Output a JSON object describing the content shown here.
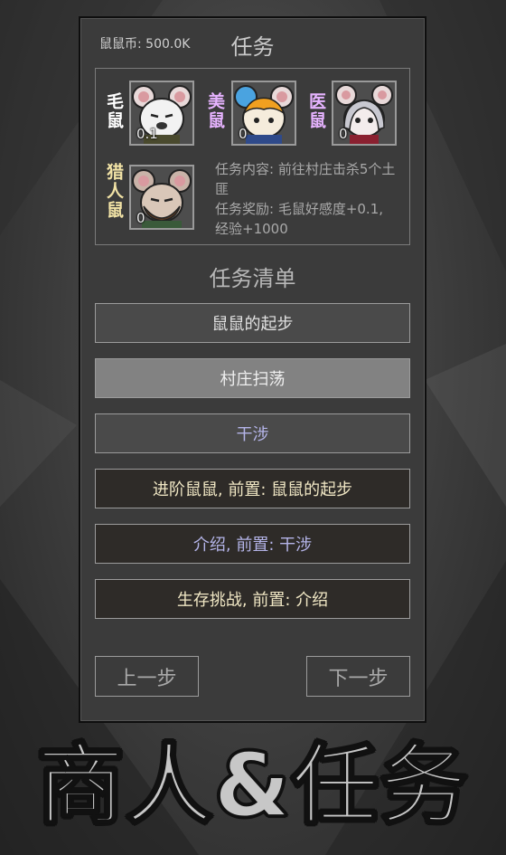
{
  "header": {
    "coin_label": "鼠鼠币: 500.0K",
    "title": "任务"
  },
  "roster": [
    {
      "name": "毛鼠",
      "affinity": "0.1",
      "color": "#ffffff",
      "icon": "white-rat-portrait"
    },
    {
      "name": "美鼠",
      "affinity": "0",
      "color": "#e6b3ff",
      "icon": "orange-hair-rat-portrait"
    },
    {
      "name": "医鼠",
      "affinity": "0",
      "color": "#e6b3ff",
      "icon": "silver-hair-rat-portrait"
    },
    {
      "name": "猎人鼠",
      "affinity": "0",
      "color": "#f2e3a6",
      "icon": "bearded-hunter-rat-portrait"
    }
  ],
  "mission": {
    "content": "任务内容: 前往村庄击杀5个土匪",
    "reward": "任务奖励: 毛鼠好感度+0.1, 经验+1000"
  },
  "quest_list": {
    "title": "任务清单",
    "items": [
      {
        "label": "鼠鼠的起步"
      },
      {
        "label": "村庄扫荡"
      },
      {
        "label": "干涉"
      },
      {
        "label": "进阶鼠鼠, 前置: 鼠鼠的起步"
      },
      {
        "label": "介绍, 前置: 干涉"
      },
      {
        "label": "生存挑战, 前置: 介绍"
      }
    ]
  },
  "nav": {
    "prev_label": "上一步",
    "next_label": "下一步"
  },
  "banner": "商人&任务"
}
